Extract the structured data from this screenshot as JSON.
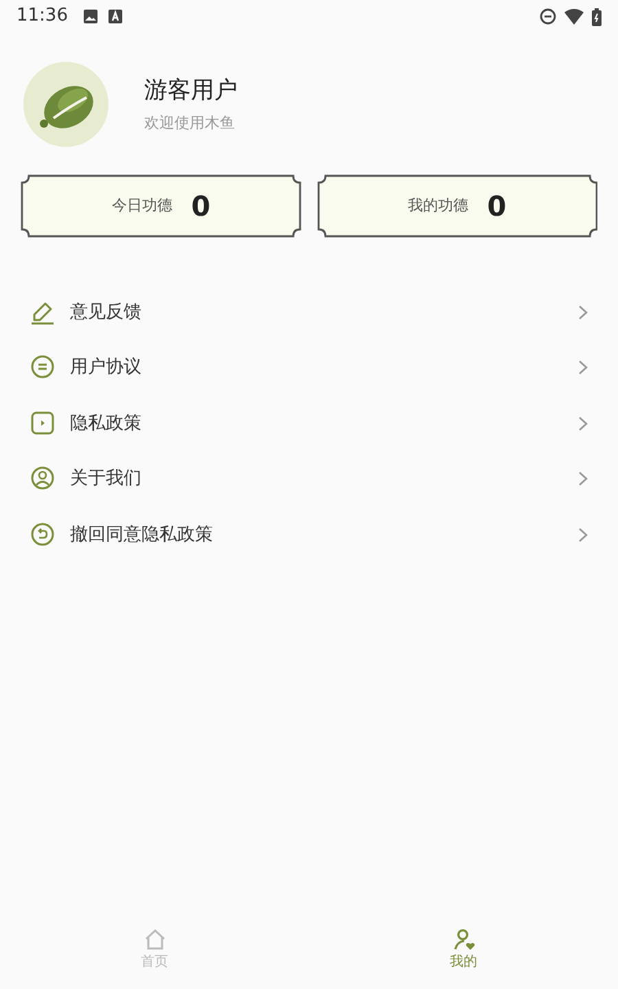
{
  "status_bar": {
    "time": "11:36"
  },
  "profile": {
    "name": "游客用户",
    "subtitle": "欢迎使用木鱼"
  },
  "stats": [
    {
      "label": "今日功德",
      "value": "0"
    },
    {
      "label": "我的功德",
      "value": "0"
    }
  ],
  "menu": [
    {
      "kind": "feedback",
      "label": "意见反馈"
    },
    {
      "kind": "agreement",
      "label": "用户协议"
    },
    {
      "kind": "privacy",
      "label": "隐私政策"
    },
    {
      "kind": "about",
      "label": "关于我们"
    },
    {
      "kind": "revoke",
      "label": "撤回同意隐私政策"
    }
  ],
  "bottom_nav": [
    {
      "kind": "home",
      "label": "首页",
      "selected": false
    },
    {
      "kind": "mine",
      "label": "我的",
      "selected": true
    }
  ]
}
